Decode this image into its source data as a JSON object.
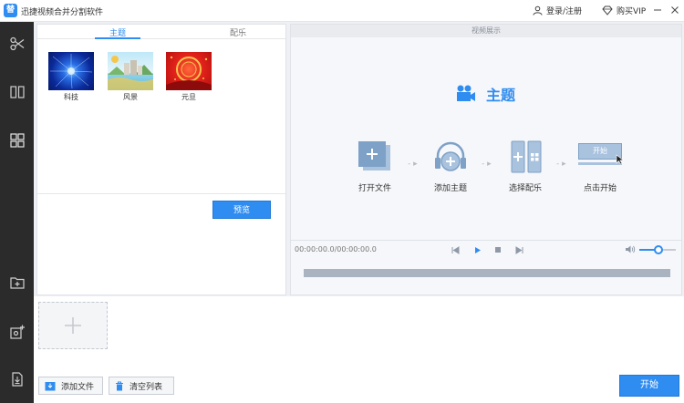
{
  "titlebar": {
    "app_logo": "替",
    "app_title": "迅捷视频合并分割软件",
    "login_label": "登录/注册",
    "vip_label": "购买VIP"
  },
  "sidebar": {
    "items": [
      {
        "name": "cut",
        "icon": "scissors-icon"
      },
      {
        "name": "split",
        "icon": "split-panel-icon"
      },
      {
        "name": "theme",
        "icon": "grid-icon",
        "active": true
      },
      {
        "name": "add-folder",
        "icon": "folder-plus-icon"
      },
      {
        "name": "settings-add",
        "icon": "gear-plus-icon"
      },
      {
        "name": "export",
        "icon": "file-export-icon"
      }
    ]
  },
  "theme_panel": {
    "tabs": [
      {
        "label": "主题",
        "active": true
      },
      {
        "label": "配乐",
        "active": false
      }
    ],
    "themes": [
      {
        "label": "科技"
      },
      {
        "label": "风景"
      },
      {
        "label": "元旦"
      }
    ],
    "preview_label": "预览"
  },
  "video_panel": {
    "title": "视频展示",
    "heading": "主题",
    "steps": [
      {
        "label": "打开文件"
      },
      {
        "label": "添加主题"
      },
      {
        "label": "选择配乐"
      },
      {
        "label": "点击开始",
        "button_text": "开始"
      }
    ],
    "time": "00:00:00.0/00:00:00.0"
  },
  "bottom": {
    "add_file_label": "添加文件",
    "clear_list_label": "清空列表",
    "start_label": "开始"
  },
  "colors": {
    "accent": "#2f8cf0",
    "sidebar_bg": "#2b2b2b"
  }
}
